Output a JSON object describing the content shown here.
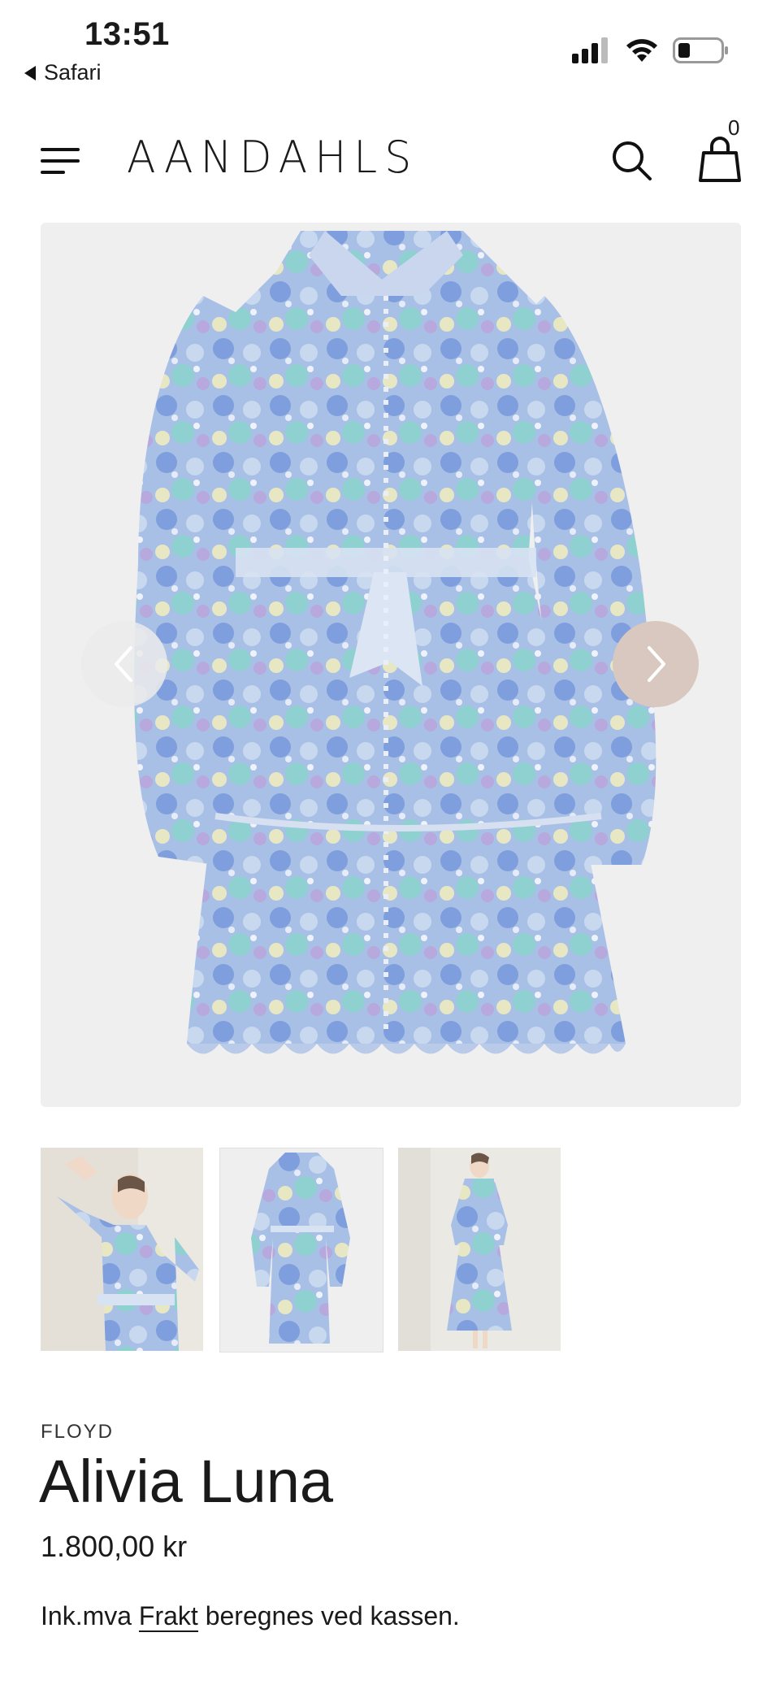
{
  "status_bar": {
    "time": "13:51",
    "back_app": "Safari"
  },
  "header": {
    "logo": "AANDAHLS",
    "cart_count": "0"
  },
  "gallery": {
    "main_alt": "Alivia Luna floral lace dress",
    "thumbnails": [
      "Model wearing dress, arm raised",
      "Dress front view",
      "Model wearing dress, full length"
    ]
  },
  "product": {
    "brand": "FLOYD",
    "name": "Alivia Luna",
    "price": "1.800,00 kr",
    "tax_prefix": "Ink.mva",
    "shipping_link": "Frakt",
    "tax_suffix": "beregnes ved kassen."
  },
  "colors": {
    "accent_arrow": "#d9c8bf",
    "image_bg": "#efefef"
  }
}
